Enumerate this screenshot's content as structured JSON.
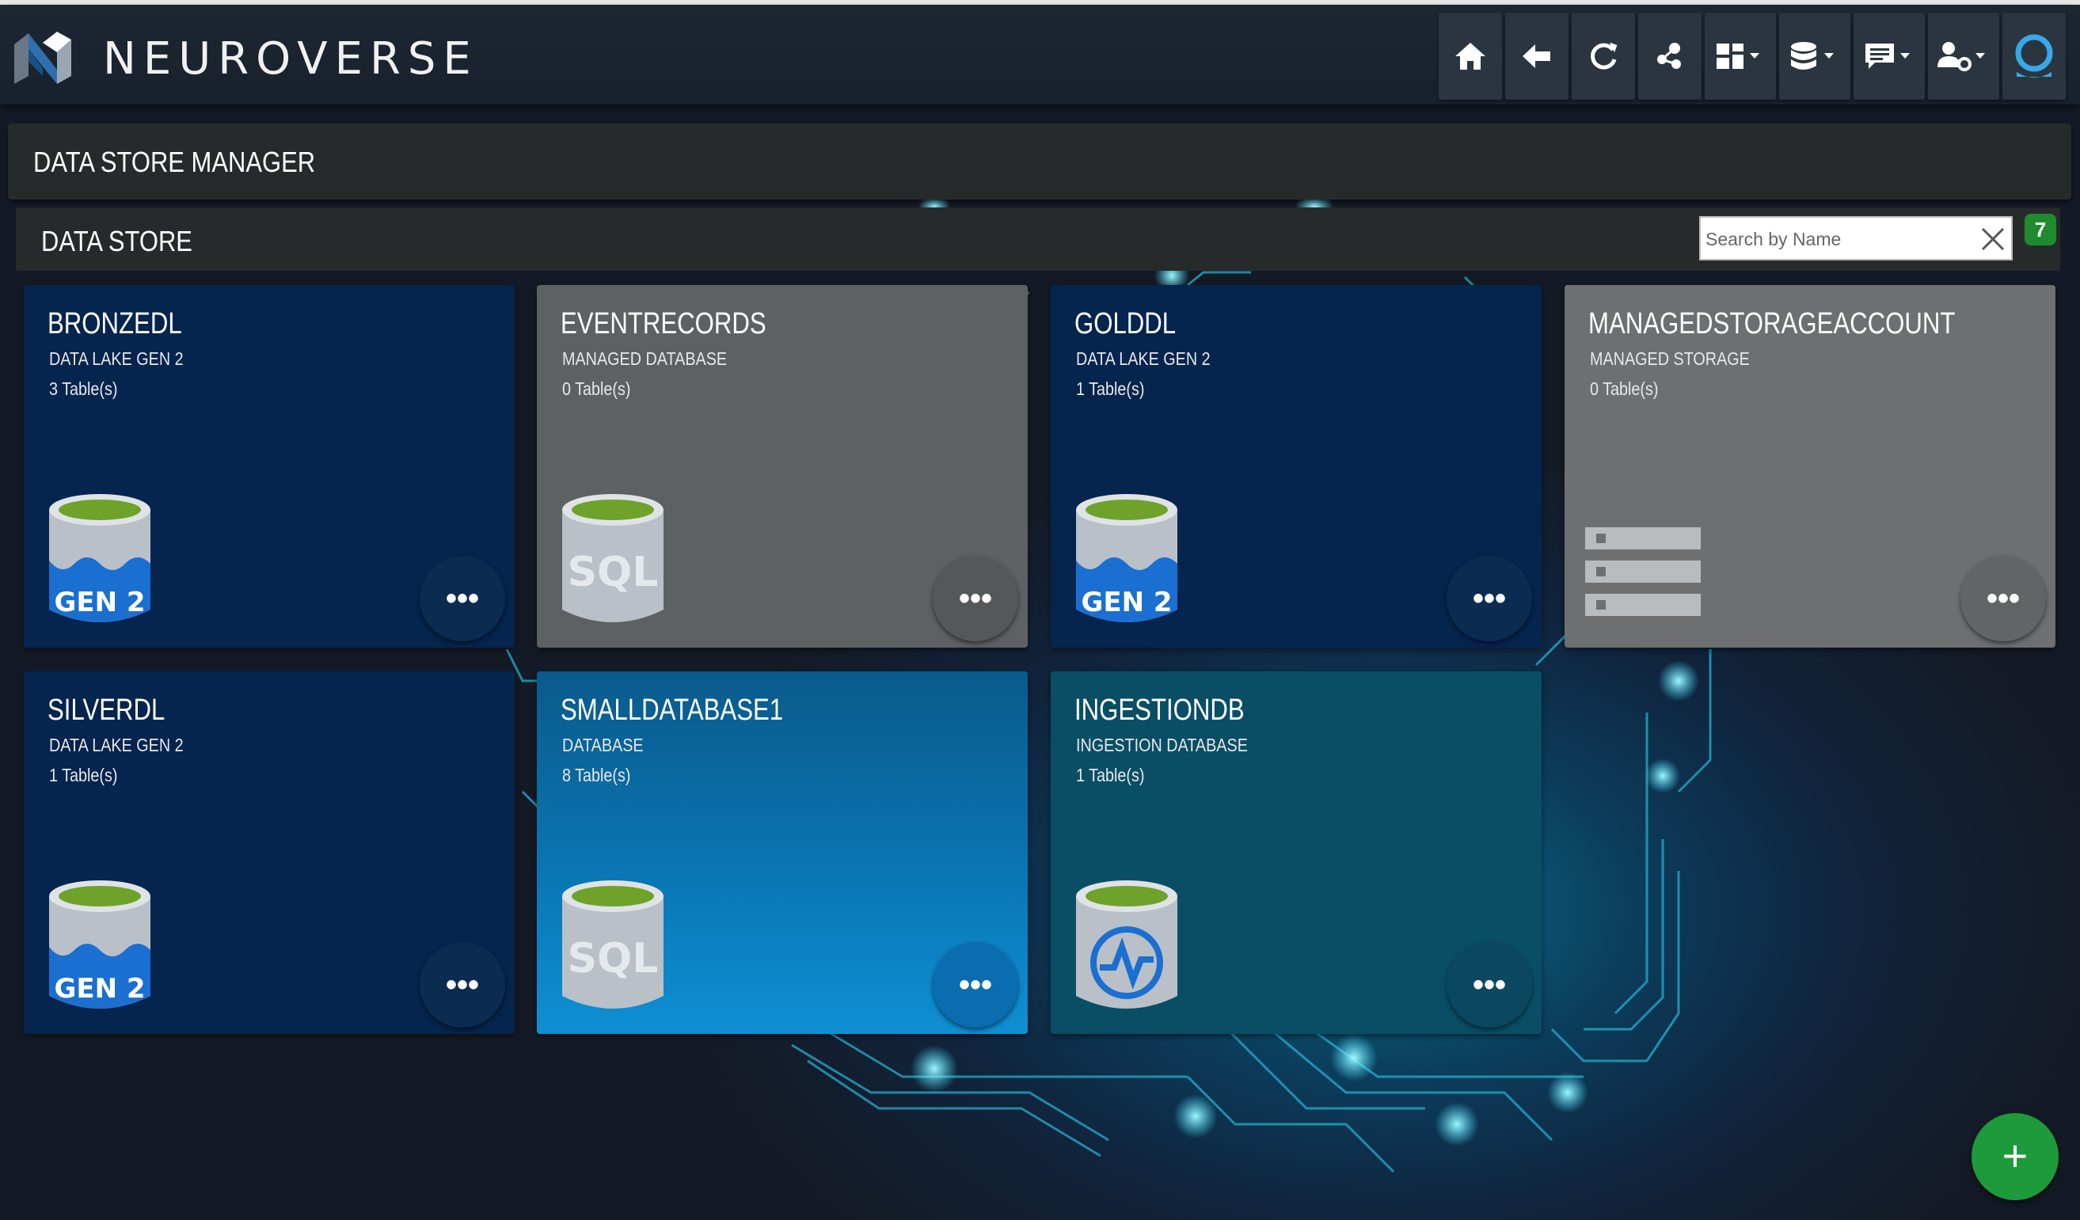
{
  "app": {
    "brand": "NEUROVERSE"
  },
  "nav": {
    "buttons": [
      {
        "icon": "home-icon"
      },
      {
        "icon": "back-arrow-icon"
      },
      {
        "icon": "refresh-icon"
      },
      {
        "icon": "share-nodes-icon"
      },
      {
        "icon": "dashboard-icon"
      },
      {
        "icon": "database-icon"
      },
      {
        "icon": "messages-icon"
      },
      {
        "icon": "user-settings-icon"
      },
      {
        "icon": "profile-icon"
      }
    ]
  },
  "page": {
    "title": "DATA STORE MANAGER"
  },
  "store": {
    "title": "DATA STORE",
    "search_placeholder": "Search by Name",
    "count": "7"
  },
  "cards": [
    {
      "name": "BRONZEDL",
      "type": "DATA LAKE GEN 2",
      "tables": "3 Table(s)",
      "icon": "gen2-datalake-icon",
      "icon_label": "GEN 2"
    },
    {
      "name": "EVENTRECORDS",
      "type": "MANAGED DATABASE",
      "tables": "0 Table(s)",
      "icon": "sql-database-icon",
      "icon_label": "SQL"
    },
    {
      "name": "GOLDDL",
      "type": "DATA LAKE GEN 2",
      "tables": "1 Table(s)",
      "icon": "gen2-datalake-icon",
      "icon_label": "GEN 2"
    },
    {
      "name": "MANAGEDSTORAGEACCOUNT",
      "type": "MANAGED STORAGE",
      "tables": "0 Table(s)",
      "icon": "storage-account-icon"
    },
    {
      "name": "SILVERDL",
      "type": "DATA LAKE GEN 2",
      "tables": "1 Table(s)",
      "icon": "gen2-datalake-icon",
      "icon_label": "GEN 2"
    },
    {
      "name": "SMALLDATABASE1",
      "type": "DATABASE",
      "tables": "8 Table(s)",
      "icon": "sql-database-icon",
      "icon_label": "SQL"
    },
    {
      "name": "INGESTIONDB",
      "type": "INGESTION DATABASE",
      "tables": "1 Table(s)",
      "icon": "ingestion-database-icon"
    }
  ],
  "actions": {
    "more_label": "•••",
    "add_label": "+"
  }
}
